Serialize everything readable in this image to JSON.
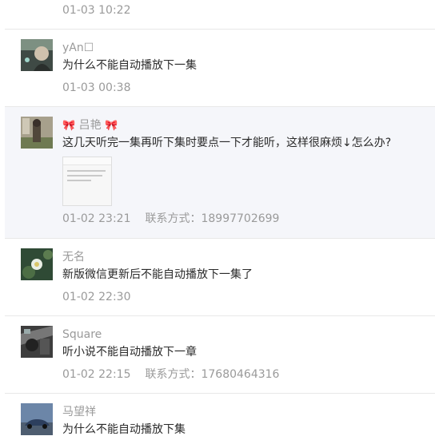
{
  "top_time": "01-03 10:22",
  "comments": [
    {
      "name": "yAn☐",
      "content": "为什么不能自动播放下一集",
      "time": "01-03 00:38",
      "contact": ""
    },
    {
      "name": "吕艳",
      "name_decoration": "🎀",
      "content": "这几天听完一集再听下集时要点一下才能听，这样很麻烦↓怎么办?",
      "time": "01-02 23:21",
      "contact": "联系方式：18997702699",
      "has_attachment": true
    },
    {
      "name": "无名",
      "content": "新版微信更新后不能自动播放下一集了",
      "time": "01-02 22:30",
      "contact": ""
    },
    {
      "name": "Square",
      "content": "听小说不能自动播放下一章",
      "time": "01-02 22:15",
      "contact": "联系方式：17680464316"
    },
    {
      "name": "马望祥",
      "content": "为什么不能自动播放下集",
      "time": "",
      "contact": ""
    }
  ],
  "colors": {
    "highlight_bg": "#f5f6fa",
    "divider": "#e8e8e8",
    "meta_text": "#9a9a9a",
    "body_text": "#2a2a2a"
  }
}
